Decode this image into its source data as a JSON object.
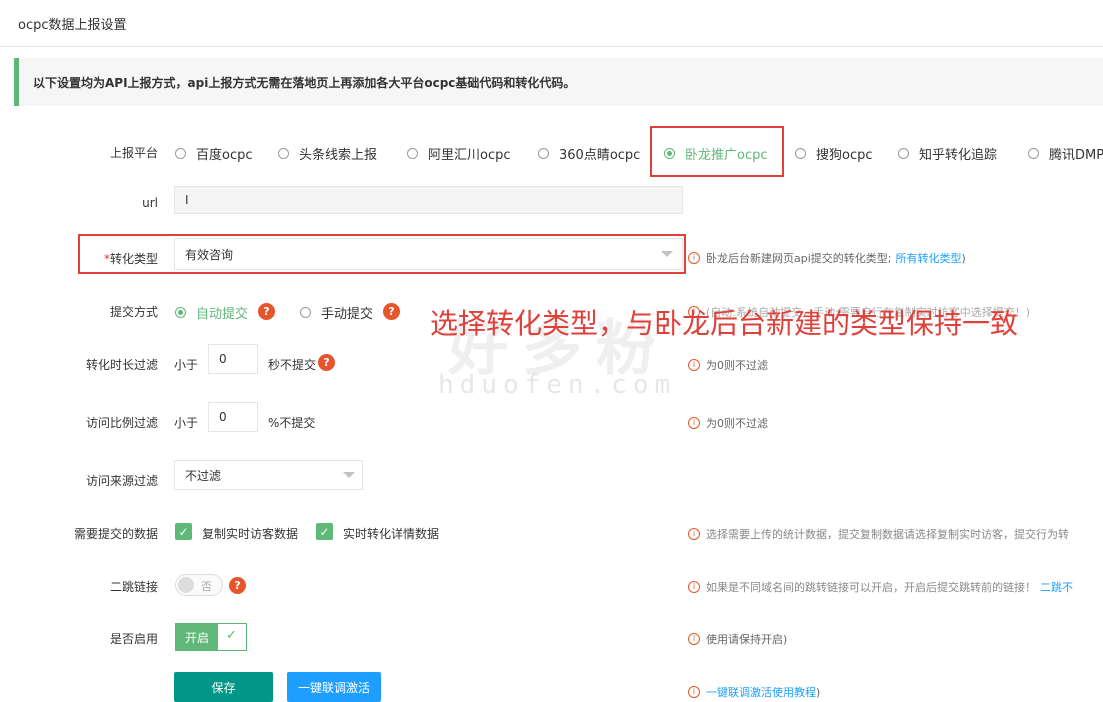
{
  "page_title": "ocpc数据上报设置",
  "notice": "以下设置均为API上报方式，api上报方式无需在落地页上再添加各大平台ocpc基础代码和转化代码。",
  "platform": {
    "label": "上报平台",
    "options": [
      "百度ocpc",
      "头条线索上报",
      "阿里汇川ocpc",
      "360点睛ocpc",
      "卧龙推广ocpc",
      "搜狗ocpc",
      "知乎转化追踪",
      "腾讯DMP"
    ],
    "selected": "卧龙推广ocpc"
  },
  "url": {
    "label": "url",
    "value": "I"
  },
  "conversion_type": {
    "required_mark": "*",
    "label": "转化类型",
    "value": "有效咨询",
    "hint": "卧龙后台新建网页api提交的转化类型;",
    "hint_link": "所有转化类型",
    "hint_close": ")"
  },
  "submit_mode": {
    "label": "提交方式",
    "options": [
      "自动提交",
      "手动提交"
    ],
    "selected": "自动提交",
    "hint": "(自动:系统自动提交，手动:需要自行在复制实时访客中选择提交！)"
  },
  "duration_filter": {
    "label": "转化时长过滤",
    "prefix": "小于",
    "value": "0",
    "suffix": "秒不提交",
    "hint": "为0则不过滤"
  },
  "ratio_filter": {
    "label": "访问比例过滤",
    "prefix": "小于",
    "value": "0",
    "suffix": "%不提交",
    "hint": "为0则不过滤"
  },
  "source_filter": {
    "label": "访问来源过滤",
    "value": "不过滤"
  },
  "data_submit": {
    "label": "需要提交的数据",
    "items": [
      "复制实时访客数据",
      "实时转化详情数据"
    ],
    "hint": "选择需要上传的统计数据，提交复制数据请选择复制实时访客，提交行为转"
  },
  "second_jump": {
    "label": "二跳链接",
    "toggle_text": "否",
    "hint": "如果是不同域名间的跳转链接可以开启，开启后提交跳转前的链接！",
    "hint_link": "二跳不"
  },
  "enabled": {
    "label": "是否启用",
    "toggle_text": "开启",
    "hint": "使用请保持开启)"
  },
  "buttons": {
    "save": "保存",
    "activate": "一键联调激活"
  },
  "bottom_hint": {
    "link": "一键联调激活使用教程",
    "close": ")"
  },
  "annotation": "选择转化类型，与卧龙后台新建的类型保持一致",
  "watermark": {
    "text": "好多粉",
    "url": "hduofen.com"
  },
  "colors": {
    "accent_green": "#5fb878",
    "link_blue": "#1e9fff",
    "help_orange": "#e8552c",
    "annotation_red": "#e0403a"
  }
}
